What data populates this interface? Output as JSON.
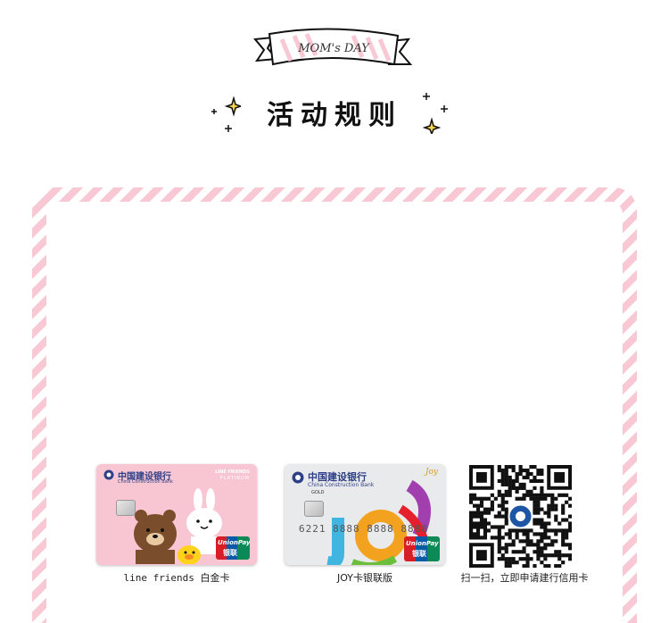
{
  "banner": {
    "text": "MOM's DAY"
  },
  "title": "活动规则",
  "cards": [
    {
      "bank_name": "中国建设银行",
      "bank_en": "China Construction Bank",
      "tier_brand": "LINE FRIENDS",
      "tier": "PLATINUM",
      "network": "UnionPay",
      "network_cn": "银联",
      "caption": "line friends 白金卡"
    },
    {
      "bank_name": "中国建设银行",
      "bank_en": "China Construction Bank",
      "tier": "GOLD",
      "brand": "Joy",
      "number": "6221 8888 8888 8888",
      "network": "UnionPay",
      "network_cn": "银联",
      "caption": "JOY卡银联版"
    }
  ],
  "qr": {
    "caption": "扫一扫，立即申请建行信用卡"
  },
  "colors": {
    "stripe": "#f8c8d4",
    "bank_blue": "#2d3f86",
    "union_red": "#d71d26",
    "union_blue": "#0a5aa6",
    "union_green": "#0b8a57"
  }
}
